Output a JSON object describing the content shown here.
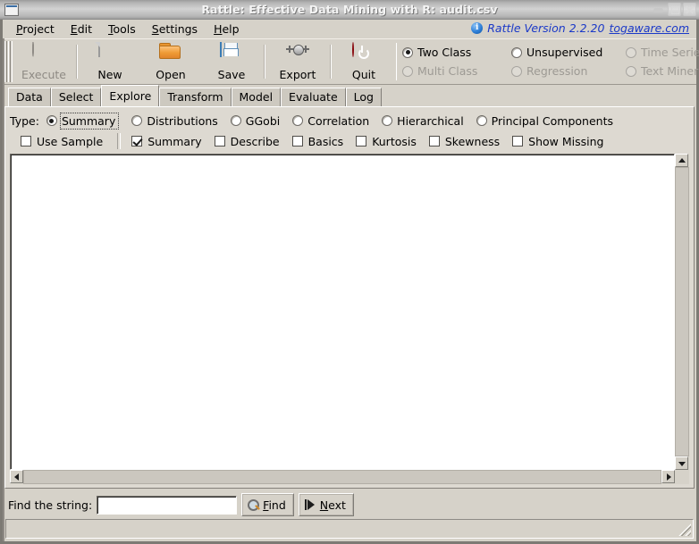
{
  "window": {
    "title": "Rattle: Effective Data Mining with R: audit.csv",
    "app_icon": "window-icon",
    "buttons": [
      {
        "name": "minimize-button",
        "glyph": "minimize-icon"
      },
      {
        "name": "maximize-button",
        "glyph": "maximize-icon"
      },
      {
        "name": "close-button",
        "glyph": "close-icon"
      }
    ]
  },
  "menubar": {
    "items": [
      {
        "label": "Project",
        "mnemonic": "P",
        "rest": "roject"
      },
      {
        "label": "Edit",
        "mnemonic": "E",
        "rest": "dit"
      },
      {
        "label": "Tools",
        "mnemonic": "T",
        "rest": "ools"
      },
      {
        "label": "Settings",
        "mnemonic": "S",
        "rest": "ettings"
      },
      {
        "label": "Help",
        "mnemonic": "H",
        "rest": "elp"
      }
    ]
  },
  "version_bar": {
    "info_icon": "info-icon",
    "glyph": "i",
    "text": "Rattle Version 2.2.20",
    "link": "togaware.com",
    "color": "#1b39c8"
  },
  "toolbar": {
    "items": [
      {
        "label": "Execute",
        "icon": "cog-icon",
        "disabled": true
      },
      {
        "label": "New",
        "icon": "page-icon",
        "disabled": false
      },
      {
        "label": "Open",
        "icon": "folder-icon",
        "disabled": false
      },
      {
        "label": "Save",
        "icon": "floppy-icon",
        "disabled": false
      },
      {
        "label": "Export",
        "icon": "connector-icon",
        "disabled": false
      },
      {
        "label": "Quit",
        "icon": "power-icon",
        "disabled": false
      }
    ]
  },
  "class_panel": {
    "options": [
      {
        "label": "Two Class",
        "selected": true,
        "disabled": false
      },
      {
        "label": "Unsupervised",
        "selected": false,
        "disabled": false
      },
      {
        "label": "Time Series",
        "selected": false,
        "disabled": true
      },
      {
        "label": "Multi Class",
        "selected": false,
        "disabled": true
      },
      {
        "label": "Regression",
        "selected": false,
        "disabled": true
      },
      {
        "label": "Text Miner",
        "selected": false,
        "disabled": true
      }
    ]
  },
  "tabs": {
    "items": [
      {
        "label": "Data",
        "active": false
      },
      {
        "label": "Select",
        "active": false
      },
      {
        "label": "Explore",
        "active": true
      },
      {
        "label": "Transform",
        "active": false
      },
      {
        "label": "Model",
        "active": false
      },
      {
        "label": "Evaluate",
        "active": false
      },
      {
        "label": "Log",
        "active": false
      }
    ]
  },
  "explore": {
    "type_label": "Type:",
    "type_options": [
      {
        "label": "Summary",
        "selected": true,
        "focused": true
      },
      {
        "label": "Distributions",
        "selected": false,
        "focused": false
      },
      {
        "label": "GGobi",
        "selected": false,
        "focused": false
      },
      {
        "label": "Correlation",
        "selected": false,
        "focused": false
      },
      {
        "label": "Hierarchical",
        "selected": false,
        "focused": false
      },
      {
        "label": "Principal Components",
        "selected": false,
        "focused": false
      }
    ],
    "checkboxes": [
      {
        "label": "Use Sample",
        "checked": false,
        "separator_after": true
      },
      {
        "label": "Summary",
        "checked": true,
        "separator_after": false
      },
      {
        "label": "Describe",
        "checked": false,
        "separator_after": false
      },
      {
        "label": "Basics",
        "checked": false,
        "separator_after": false
      },
      {
        "label": "Kurtosis",
        "checked": false,
        "separator_after": false
      },
      {
        "label": "Skewness",
        "checked": false,
        "separator_after": false
      },
      {
        "label": "Show Missing",
        "checked": false,
        "separator_after": false
      }
    ],
    "textview_content": ""
  },
  "scrollbars": {
    "vertical": {
      "up": "arrow-up-icon",
      "down": "arrow-down-icon"
    },
    "horizontal": {
      "left": "arrow-left-icon",
      "right": "arrow-right-icon"
    }
  },
  "findbar": {
    "label": "Find the string:",
    "input_value": "",
    "input_placeholder": "",
    "find_button": {
      "icon": "magnifier-icon",
      "mnemonic": "F",
      "rest": "ind"
    },
    "next_button": {
      "icon": "skip-next-icon",
      "mnemonic": "N",
      "rest": "ext"
    }
  },
  "statusbar": {
    "text": "",
    "grip": "resize-grip-icon"
  }
}
